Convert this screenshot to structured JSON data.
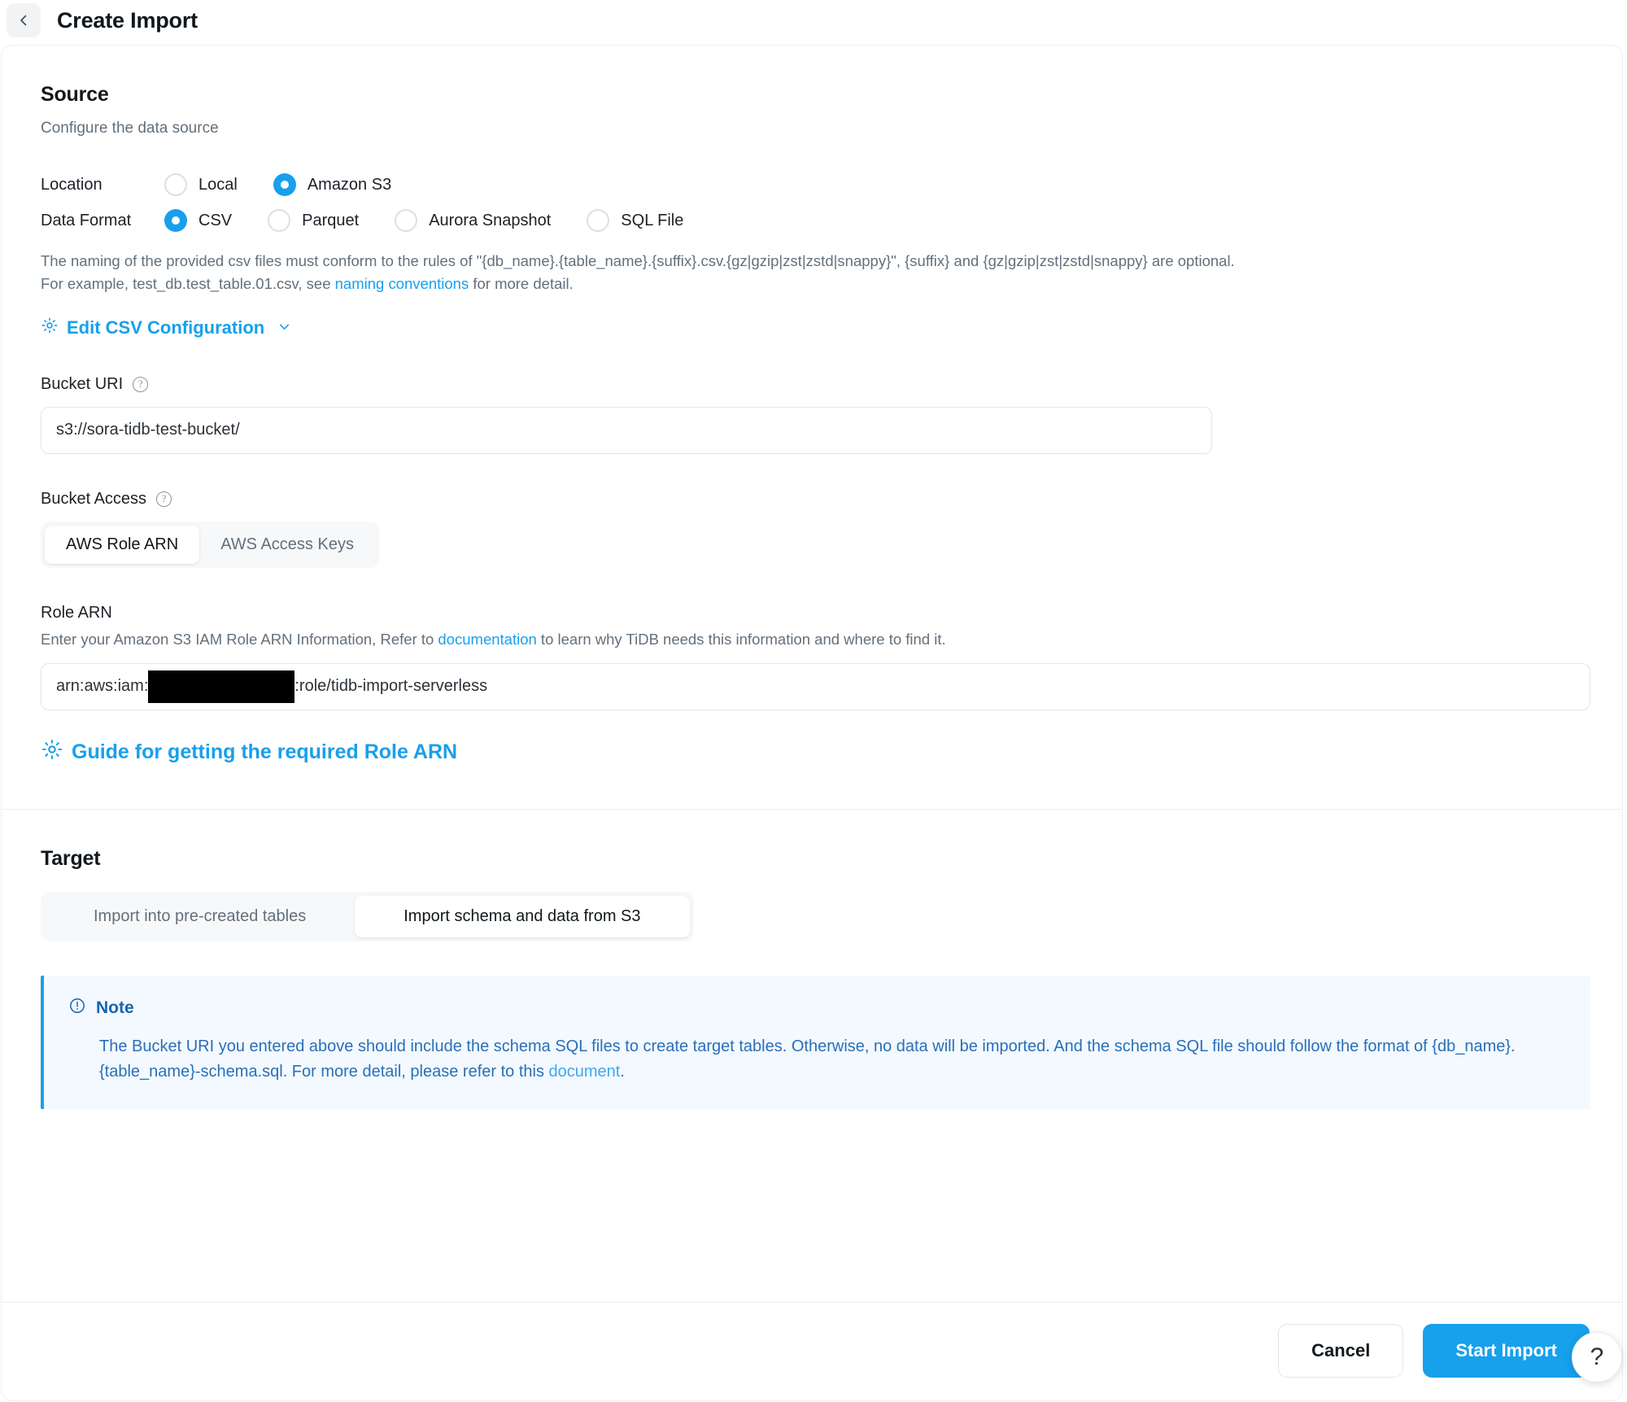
{
  "header": {
    "back_icon": "chevron-left-icon",
    "title": "Create Import"
  },
  "source": {
    "title": "Source",
    "subtitle": "Configure the data source",
    "location": {
      "label": "Location",
      "options": [
        "Local",
        "Amazon S3"
      ],
      "selected": "Amazon S3"
    },
    "data_format": {
      "label": "Data Format",
      "options": [
        "CSV",
        "Parquet",
        "Aurora Snapshot",
        "SQL File"
      ],
      "selected": "CSV"
    },
    "naming_hint": {
      "part1": "The naming of the provided csv files must conform to the rules of \"{db_name}.{table_name}.{suffix}.csv.{gz|gzip|zst|zstd|snappy}\", {suffix} and {gz|gzip|zst|zstd|snappy} are optional. For example, test_db.test_table.01.csv, see ",
      "link": "naming conventions",
      "part2": " for more detail."
    },
    "edit_csv_config": {
      "icon": "gear-icon",
      "label": "Edit CSV Configuration",
      "chevron": "chevron-down-icon"
    },
    "bucket_uri": {
      "label": "Bucket URI",
      "help_icon": "question-circle-icon",
      "value": "s3://sora-tidb-test-bucket/"
    },
    "bucket_access": {
      "label": "Bucket Access",
      "help_icon": "question-circle-icon",
      "tabs": [
        "AWS Role ARN",
        "AWS Access Keys"
      ],
      "selected": "AWS Role ARN"
    },
    "role_arn": {
      "label": "Role ARN",
      "hint_part1": "Enter your Amazon S3 IAM Role ARN Information, Refer to ",
      "hint_link": "documentation",
      "hint_part2": " to learn why TiDB needs this information and where to find it.",
      "value_prefix": "arn:aws:iam:",
      "value_redacted": "",
      "value_suffix": ":role/tidb-import-serverless"
    },
    "guide_link": {
      "icon": "gear-icon",
      "label": "Guide for getting the required Role ARN"
    }
  },
  "target": {
    "title": "Target",
    "tabs": [
      "Import into pre-created tables",
      "Import schema and data from S3"
    ],
    "selected": "Import schema and data from S3",
    "note": {
      "icon": "info-circle-icon",
      "title": "Note",
      "body_part1": "The Bucket URI you entered above should include the schema SQL files to create target tables. Otherwise, no data will be imported. And the schema SQL file should follow the format of {db_name}.{table_name}-schema.sql. For more detail, please refer to this ",
      "body_link": "document",
      "body_part2": "."
    }
  },
  "footer": {
    "cancel_label": "Cancel",
    "start_import_label": "Start Import"
  },
  "help_fab": {
    "label": "?"
  },
  "colors": {
    "accent": "#17a0ec",
    "text": "#1c2127",
    "muted": "#63707c",
    "note_bg": "#f3f9fe",
    "note_text": "#2a6fb8",
    "border": "#eceef0"
  }
}
